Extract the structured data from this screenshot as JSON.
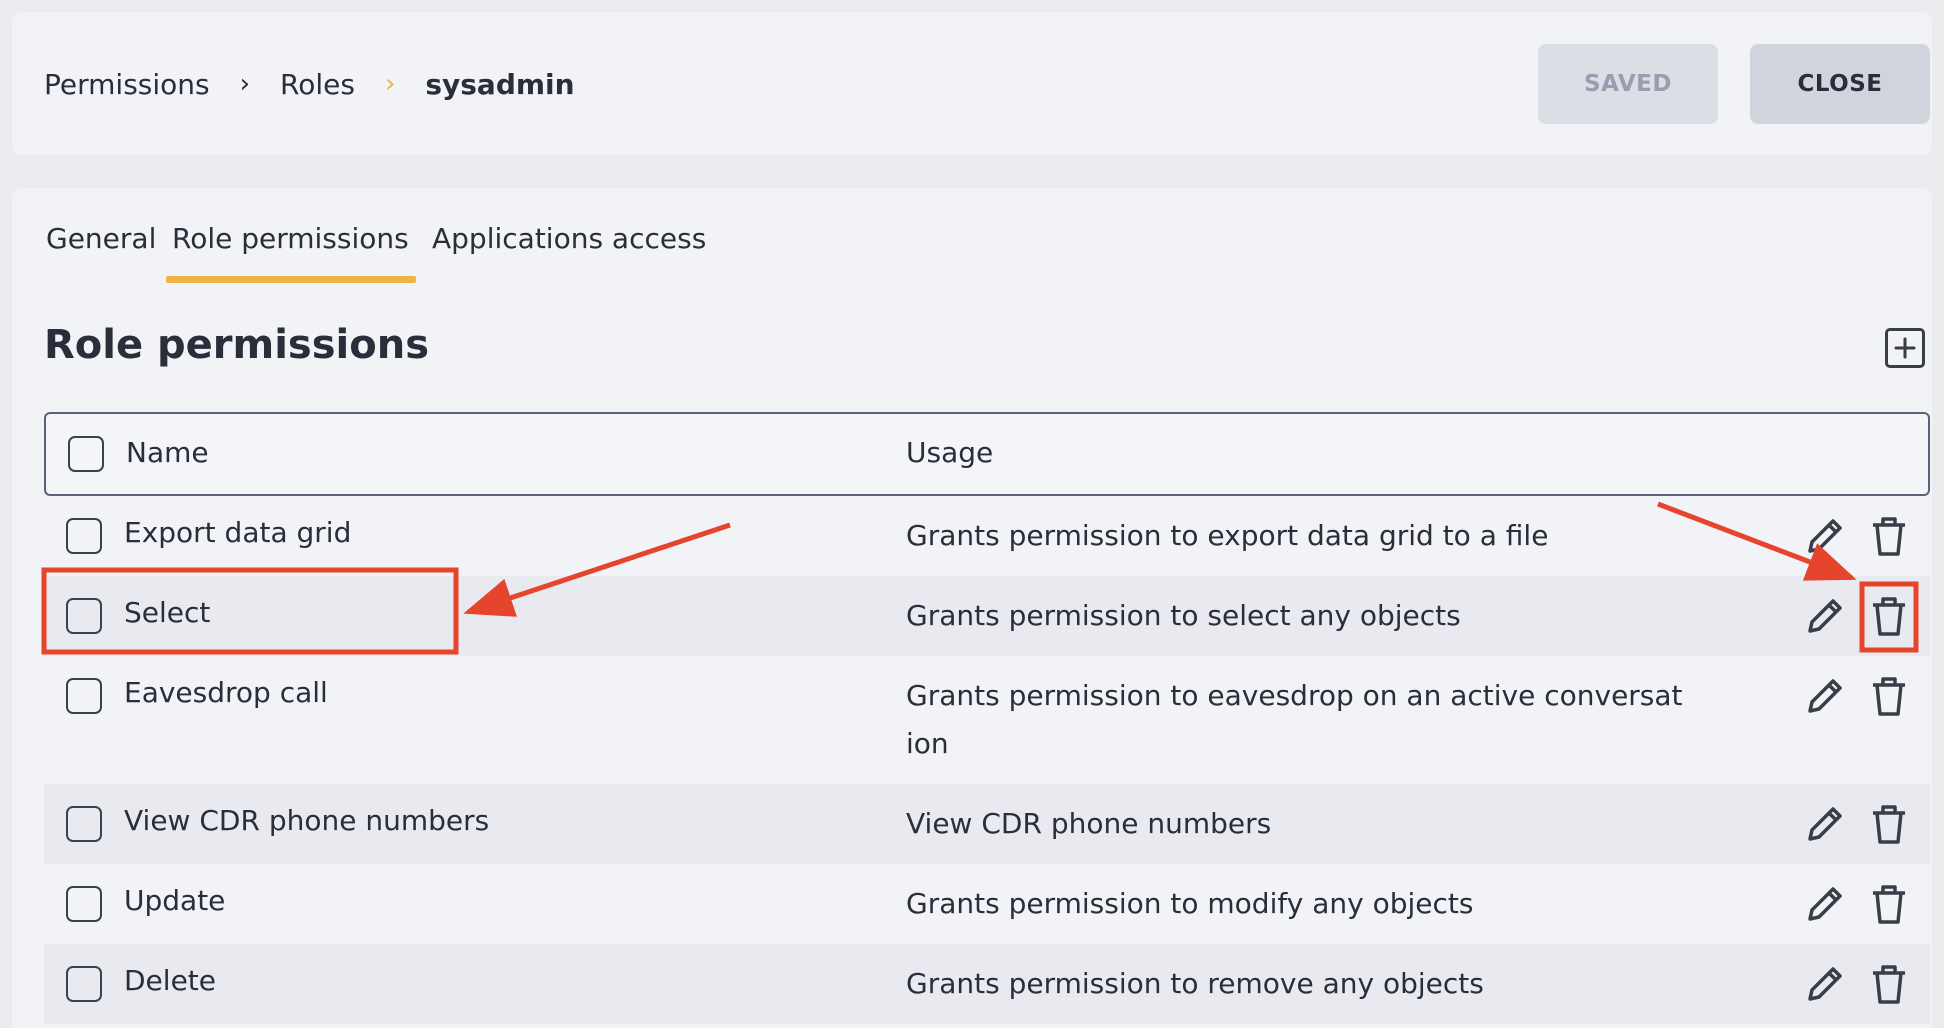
{
  "breadcrumb": {
    "items": [
      "Permissions",
      "Roles",
      "sysadmin"
    ],
    "separator": "›"
  },
  "header_buttons": {
    "saved_label": "SAVED",
    "close_label": "CLOSE"
  },
  "tabs": [
    {
      "label": "General",
      "active": false
    },
    {
      "label": "Role permissions",
      "active": true
    },
    {
      "label": "Applications access",
      "active": false
    }
  ],
  "section": {
    "title": "Role permissions",
    "add_icon": "plus-square-icon"
  },
  "table": {
    "columns": [
      "Name",
      "Usage"
    ],
    "rows": [
      {
        "name": "Export data grid",
        "usage": "Grants permission to export data grid to a file"
      },
      {
        "name": "Select",
        "usage": "Grants permission to select any objects"
      },
      {
        "name": "Eavesdrop call",
        "usage": "Grants permission to eavesdrop on an active conversat",
        "usage_line2": "ion"
      },
      {
        "name": "View CDR phone numbers",
        "usage": "View CDR phone numbers"
      },
      {
        "name": "Update",
        "usage": "Grants permission to modify any objects"
      },
      {
        "name": "Delete",
        "usage": "Grants permission to remove any objects"
      }
    ],
    "row_actions": [
      "pencil-icon",
      "trash-icon"
    ]
  },
  "colors": {
    "accent": "#f0b34a",
    "annotation": "#e5452c",
    "text": "#2b2d3b"
  }
}
